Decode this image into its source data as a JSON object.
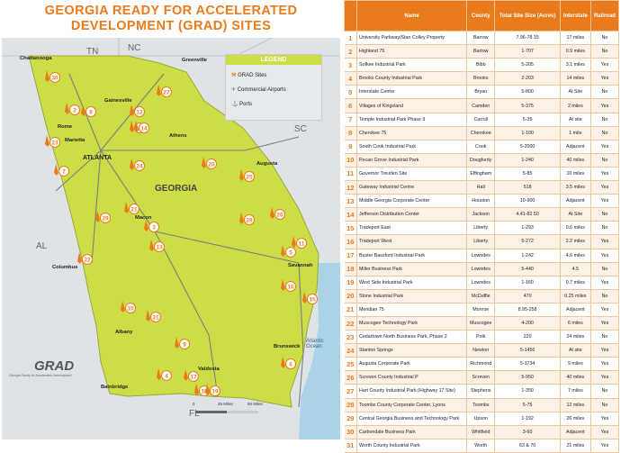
{
  "title": {
    "line1": "GEORGIA READY FOR ACCELERATED",
    "line2": "DEVELOPMENT (GRAD) SITES"
  },
  "colors": {
    "accent": "#e97b1c",
    "georgia": "#cddd45",
    "ocean": "#aad3e6",
    "land": "#dfe3e6"
  },
  "legend": {
    "title": "LEGEND",
    "items": [
      {
        "label": "GRAD Sites",
        "icon": "shovel-icon"
      },
      {
        "label": "Commercial Airports",
        "icon": "airplane-icon"
      },
      {
        "label": "Ports",
        "icon": "port-icon"
      }
    ]
  },
  "map": {
    "states": {
      "tn": "TN",
      "nc": "NC",
      "sc": "SC",
      "al": "AL",
      "fl": "FL",
      "georgia": "GEORGIA"
    },
    "cities": {
      "chattanooga": "Chattanooga",
      "greenville": "Greenville",
      "gainesville": "Gainesville",
      "rome": "Rome",
      "marietta": "Marietta",
      "athens": "Athens",
      "atlanta": "ATLANTA",
      "augusta": "Augusta",
      "macon": "Macon",
      "columbus": "Columbus",
      "savannah": "Savannah",
      "albany": "Albany",
      "brunswick": "Brunswick",
      "valdosta": "Valdosta",
      "bainbridge": "Bainbridge",
      "ocean": "Atlantic Ocean"
    },
    "scale": {
      "a": "0",
      "b": "25 Miles",
      "c": "50 Miles"
    },
    "logo": {
      "text": "GRAD",
      "sub": "Georgia Ready for Accelerated Development"
    }
  },
  "table": {
    "headers": [
      "",
      "Name",
      "County",
      "Total Site Size (Acres)",
      "Interstate",
      "Railroad"
    ],
    "rows": [
      [
        "1",
        "University Parkway/Stan Colley Property",
        "Barrow",
        "7.96-78.15",
        "17 miles",
        "No"
      ],
      [
        "2",
        "Highland 75",
        "Bartow",
        "1-707",
        "0.9 miles",
        "No"
      ],
      [
        "3",
        "Sofkee Industrial Park",
        "Bibb",
        "5-205",
        "3.1 miles",
        "Yes"
      ],
      [
        "4",
        "Brooks County Industrial Park",
        "Brooks",
        "2-203",
        "14 miles",
        "Yes"
      ],
      [
        "5",
        "Interstate Centre",
        "Bryan",
        "5-800",
        "At Site",
        "No"
      ],
      [
        "6",
        "Villages of Kingsland",
        "Camden",
        "5-375",
        "2 miles",
        "Yes"
      ],
      [
        "7",
        "Temple Industrial Park Phase II",
        "Carroll",
        "5-35",
        "At site",
        "No"
      ],
      [
        "8",
        "Cherokee 75",
        "Cherokee",
        "1-100",
        "1 mile",
        "No"
      ],
      [
        "9",
        "South Cook Industrial Park",
        "Cook",
        "5-2000",
        "Adjacent",
        "Yes"
      ],
      [
        "10",
        "Pecan Grove Industrial Park",
        "Dougherty",
        "1-240",
        "40 miles",
        "No"
      ],
      [
        "11",
        "Governor Treutlen Site",
        "Effingham",
        "5-85",
        "10 miles",
        "Yes"
      ],
      [
        "12",
        "Gateway Industrial Centre",
        "Hall",
        "518",
        "3.5 miles",
        "Yes"
      ],
      [
        "13",
        "Middle Georgia Corporate Center",
        "Houston",
        "10-900",
        "Adjacent",
        "Yes"
      ],
      [
        "14",
        "Jefferson Distribution Center",
        "Jackson",
        "4.41-82.50",
        "At Site",
        "No"
      ],
      [
        "15",
        "Tradeport East",
        "Liberty",
        "1-293",
        "0.6 miles",
        "No"
      ],
      [
        "16",
        "Tradeport West",
        "Liberty",
        "5-272",
        "2.2 miles",
        "Yes"
      ],
      [
        "17",
        "Buster Bassford Industrial Park",
        "Lowndes",
        "1-242",
        "4.6 miles",
        "Yes"
      ],
      [
        "18",
        "Miller Business Park",
        "Lowndes",
        "5-440",
        "4.5",
        "No"
      ],
      [
        "19",
        "West Side Industrial Park",
        "Lowndes",
        "1-160",
        "0.7 miles",
        "Yes"
      ],
      [
        "20",
        "Stone Industrial Park",
        "McDuffie",
        "470",
        "0.25 miles",
        "No"
      ],
      [
        "21",
        "Meridian 75",
        "Monroe",
        "8.95-258",
        "Adjacent",
        "Yes"
      ],
      [
        "22",
        "Muscogee Technology Park",
        "Muscogee",
        "4-200",
        "6 miles",
        "Yes"
      ],
      [
        "23",
        "Cedartown North Business Park, Phase 2",
        "Polk",
        "220",
        "24 miles",
        "No"
      ],
      [
        "24",
        "Stanton Springs",
        "Newton",
        "5-1456",
        "At site",
        "Yes"
      ],
      [
        "25",
        "Augusta Corporate Park",
        "Richmond",
        "5-1734",
        "9 miles",
        "Yes"
      ],
      [
        "26",
        "Screven County Industrial P",
        "Screven",
        "5-950",
        "40 miles",
        "Yes"
      ],
      [
        "27",
        "Hart County Industrial Park (Highway 17 Site)",
        "Stephens",
        "1-350",
        "7 miles",
        "No"
      ],
      [
        "28",
        "Toombs County Corporate Center, Lyons",
        "Toombs",
        "5-75",
        "12 miles",
        "No"
      ],
      [
        "29",
        "Central Georgia Business and Technology Park",
        "Upson",
        "1-192",
        "26 miles",
        "Yes"
      ],
      [
        "30",
        "Carbondale Business Park",
        "Whitfield",
        "3-60",
        "Adjacent",
        "Yes"
      ],
      [
        "31",
        "Worth County Industrial Park",
        "Worth",
        "63 & 70",
        "21 miles",
        "Yes"
      ]
    ]
  },
  "sites": [
    {
      "n": "1",
      "county": "Barrow"
    },
    {
      "n": "2",
      "county": "Bartow"
    },
    {
      "n": "3",
      "county": "Bibb"
    },
    {
      "n": "4",
      "county": "Brooks"
    },
    {
      "n": "5",
      "county": "Bryan"
    },
    {
      "n": "6",
      "county": "Camden"
    },
    {
      "n": "7",
      "county": "Carroll"
    },
    {
      "n": "8",
      "county": "Cherokee"
    },
    {
      "n": "9",
      "county": "Cook"
    },
    {
      "n": "10",
      "county": "Dougherty"
    },
    {
      "n": "11",
      "county": "Effingham"
    },
    {
      "n": "12",
      "county": "Hall"
    },
    {
      "n": "13",
      "county": "Houston"
    },
    {
      "n": "14",
      "county": "Jackson"
    },
    {
      "n": "15",
      "county": "Liberty"
    },
    {
      "n": "16",
      "county": "Liberty"
    },
    {
      "n": "17",
      "county": "Lowndes"
    },
    {
      "n": "18",
      "county": "Lowndes"
    },
    {
      "n": "19",
      "county": "Lowndes"
    },
    {
      "n": "20",
      "county": "McDuffie"
    },
    {
      "n": "21",
      "county": "Monroe"
    },
    {
      "n": "22",
      "county": "Muscogee"
    },
    {
      "n": "23",
      "county": "Polk"
    },
    {
      "n": "24",
      "county": "Newton"
    },
    {
      "n": "25",
      "county": "Richmond"
    },
    {
      "n": "26",
      "county": "Screven"
    },
    {
      "n": "27",
      "county": "Stephens"
    },
    {
      "n": "28",
      "county": "Toombs"
    },
    {
      "n": "29",
      "county": "Upson"
    },
    {
      "n": "30",
      "county": "Whitfield"
    },
    {
      "n": "31",
      "county": "Worth"
    }
  ]
}
